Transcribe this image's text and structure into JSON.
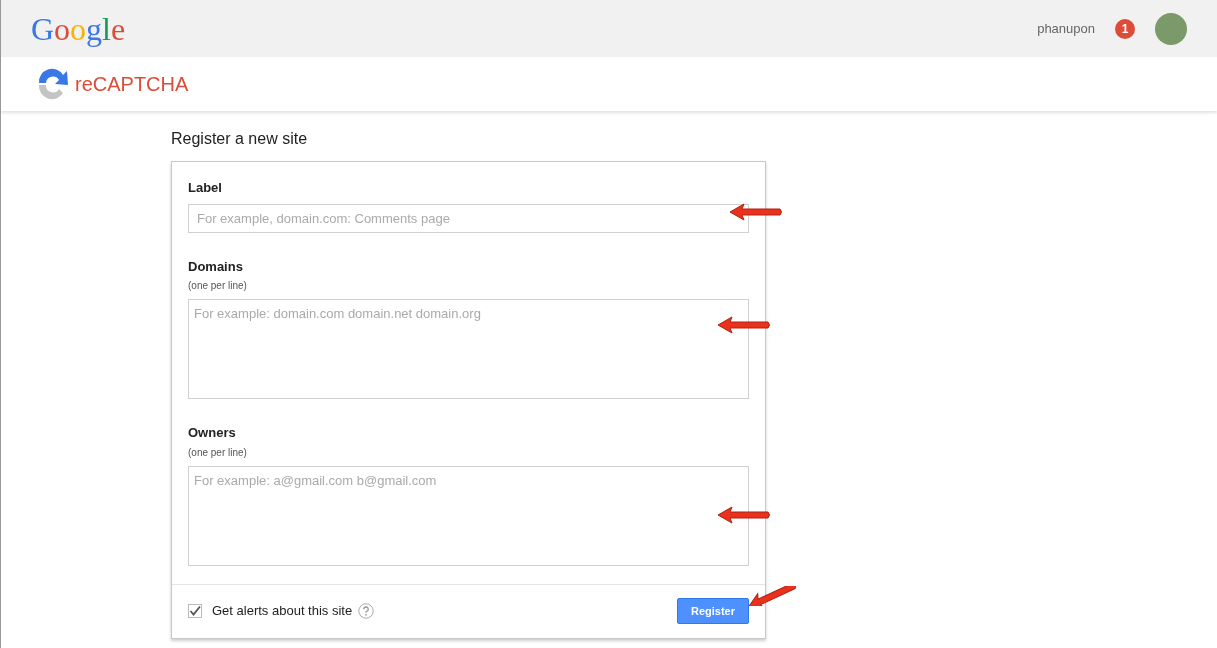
{
  "header": {
    "logo": "Google",
    "username": "phanupon",
    "notification_count": "1"
  },
  "product_bar": {
    "name": "reCAPTCHA"
  },
  "form": {
    "title": "Register a new site",
    "fields": [
      {
        "kind": "input",
        "label": "Label",
        "placeholder": "For example, domain.com: Comments page"
      },
      {
        "kind": "textarea",
        "label": "Domains",
        "hint": "(one per line)",
        "placeholder": "For example: domain.com domain.net domain.org"
      },
      {
        "kind": "textarea",
        "label": "Owners",
        "hint": "(one per line)",
        "placeholder": "For example: a@gmail.com b@gmail.com"
      }
    ],
    "alerts": {
      "label": "Get alerts about this site",
      "checked": true
    },
    "submit": "Register"
  }
}
